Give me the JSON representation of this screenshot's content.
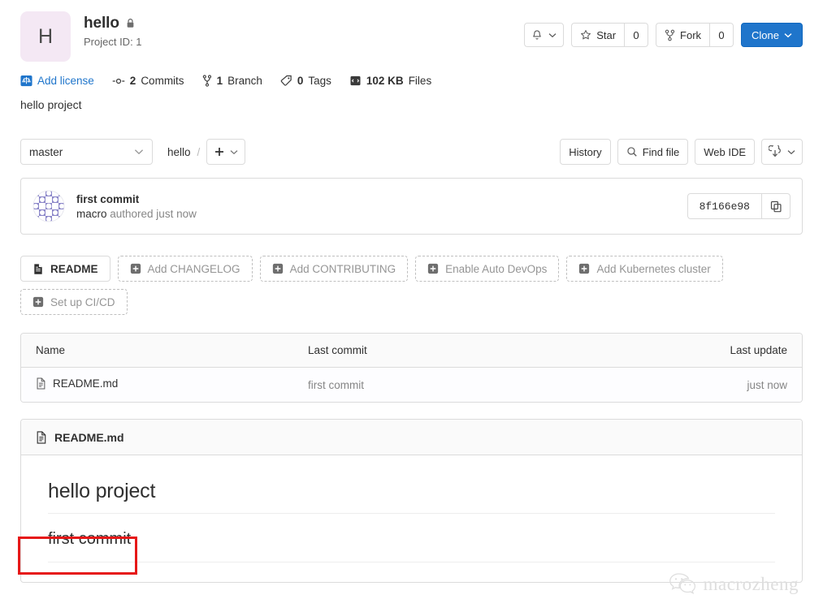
{
  "project": {
    "avatar_letter": "H",
    "avatar_bg": "#f4e8f4",
    "name": "hello",
    "visibility_icon": "lock-icon",
    "project_id_label": "Project ID: 1",
    "description": "hello project"
  },
  "header_actions": {
    "notifications_icon": "bell-icon",
    "star_label": "Star",
    "star_count": "0",
    "fork_label": "Fork",
    "fork_count": "0",
    "clone_label": "Clone",
    "clone_color": "#1f75cb"
  },
  "stats": [
    {
      "icon": "license-icon",
      "num": "",
      "label": "Add license",
      "link": true
    },
    {
      "icon": "commit-icon",
      "num": "2",
      "label": "Commits",
      "link": false
    },
    {
      "icon": "branch-icon",
      "num": "1",
      "label": "Branch",
      "link": false
    },
    {
      "icon": "tag-icon",
      "num": "0",
      "label": "Tags",
      "link": false
    },
    {
      "icon": "files-icon",
      "num": "102 KB",
      "label": "Files",
      "link": false
    }
  ],
  "filenav": {
    "branch": "master",
    "breadcrumb_root": "hello",
    "breadcrumb_separator": "/",
    "add_icon": "plus-icon",
    "history_label": "History",
    "find_file_label": "Find file",
    "find_file_icon": "search-icon",
    "web_ide_label": "Web IDE",
    "download_icon": "download-icon"
  },
  "commit": {
    "avatar_icon": "identicon-avatar",
    "title": "first commit",
    "author": "macro",
    "meta": " authored just now",
    "sha": "8f166e98",
    "copy_icon": "copy-icon"
  },
  "quick_actions": [
    {
      "label": "README",
      "style": "solid",
      "icon": "file-icon"
    },
    {
      "label": "Add CHANGELOG",
      "style": "dashed",
      "icon": "plus-square-icon"
    },
    {
      "label": "Add CONTRIBUTING",
      "style": "dashed",
      "icon": "plus-square-icon"
    },
    {
      "label": "Enable Auto DevOps",
      "style": "dashed",
      "icon": "plus-square-icon"
    },
    {
      "label": "Add Kubernetes cluster",
      "style": "dashed",
      "icon": "plus-square-icon"
    },
    {
      "label": "Set up CI/CD",
      "style": "dashed",
      "icon": "plus-square-icon"
    }
  ],
  "files_table": {
    "columns": [
      "Name",
      "Last commit",
      "Last update"
    ],
    "rows": [
      {
        "name": "README.md",
        "icon": "file-icon",
        "last_commit": "first commit",
        "last_update": "just now"
      }
    ]
  },
  "readme": {
    "header_icon": "file-icon",
    "header_title": "README.md",
    "heading": "hello project",
    "paragraph": "first commit",
    "annotation_color": "#e61717"
  },
  "watermark": {
    "icon": "wechat-icon",
    "text": "macrozheng"
  }
}
